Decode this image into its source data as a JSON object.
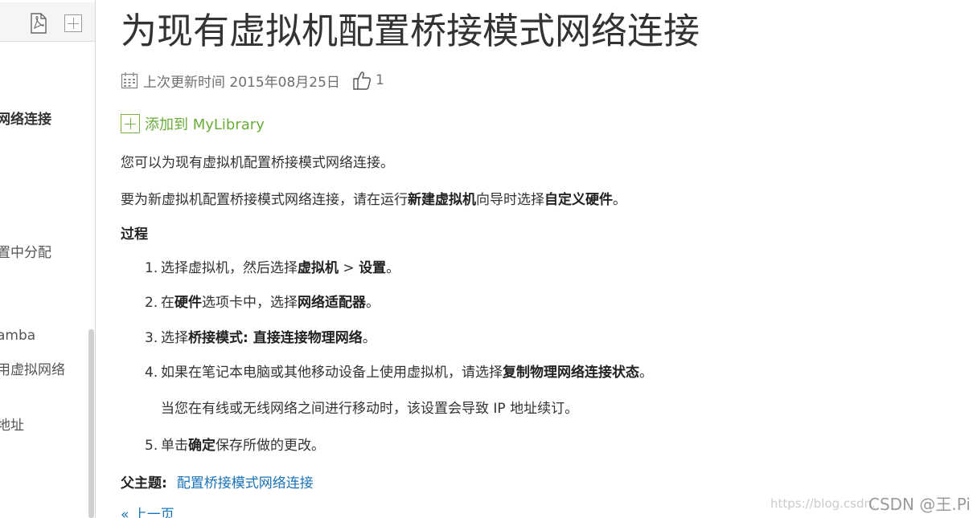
{
  "sidebar": {
    "items": [
      {
        "label": "网络连接",
        "active": true
      },
      {
        "label": "置中分配",
        "active": false
      },
      {
        "label": "amba",
        "active": false
      },
      {
        "label": "用虚拟网络",
        "active": false
      },
      {
        "label": "地址",
        "active": false
      }
    ]
  },
  "article": {
    "title": "为现有虚拟机配置桥接模式网络连接",
    "updated": "上次更新时间 2015年08月25日",
    "like_count": "1",
    "add_to_library": "添加到 MyLibrary",
    "intro": "您可以为现有虚拟机配置桥接模式网络连接。",
    "para2": {
      "pre": "要为新虚拟机配置桥接模式网络连接，请在运行",
      "b1": "新建虚拟机",
      "mid": "向导时选择",
      "b2": "自定义硬件",
      "post": "。"
    },
    "procedure_heading": "过程",
    "steps": [
      {
        "num": "1.",
        "pre": "选择虚拟机，然后选择",
        "b1": "虚拟机",
        "mid": " > ",
        "b2": "设置",
        "post": "。"
      },
      {
        "num": "2.",
        "pre": "在",
        "b1": "硬件",
        "mid": "选项卡中，选择",
        "b2": "网络适配器",
        "post": "。"
      },
      {
        "num": "3.",
        "pre": "选择",
        "b1": "桥接模式: 直接连接物理网络",
        "post": "。"
      },
      {
        "num": "4.",
        "pre": "如果在笔记本电脑或其他移动设备上使用虚拟机，请选择",
        "b1": "复制物理网络连接状态",
        "post": "。"
      },
      {
        "num": "5.",
        "pre": "单击",
        "b1": "确定",
        "post": "保存所做的更改。"
      }
    ],
    "step4_note": "当您在有线或无线网络之间进行移动时，该设置会导致 IP 地址续订。",
    "parent_topic_label": "父主题:",
    "parent_topic_link": "配置桥接模式网络连接",
    "prev_link": "« 上一页"
  },
  "watermark": {
    "url": "https://blog.csdn.",
    "brand": "CSDN @王.Pi"
  },
  "colors": {
    "link": "#1a73b8",
    "library_green": "#6aac3a",
    "text": "#333333"
  },
  "icons": [
    "pdf-icon",
    "add-icon",
    "calendar-icon",
    "thumbs-up-icon",
    "plus-box-icon"
  ]
}
